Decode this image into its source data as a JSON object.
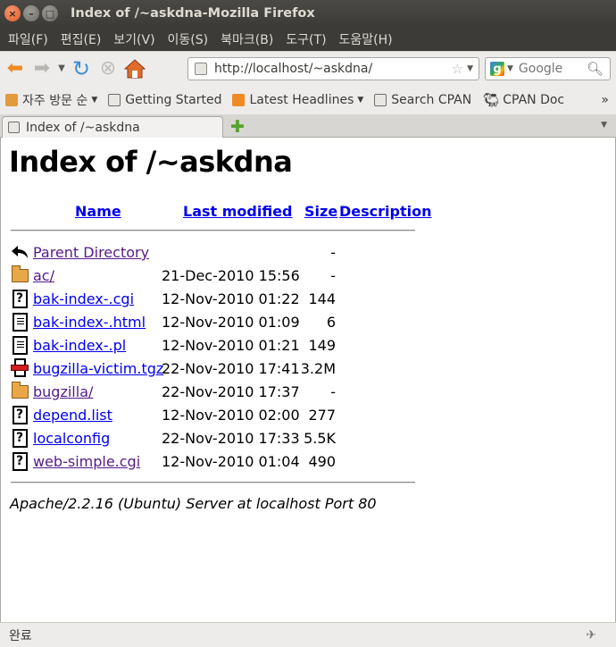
{
  "window": {
    "title": "Index of /~askdna-Mozilla Firefox"
  },
  "menu": [
    "파일(F)",
    "편집(E)",
    "보기(V)",
    "이동(S)",
    "북마크(B)",
    "도구(T)",
    "도움말(H)"
  ],
  "nav": {
    "url": "http://localhost/~askdna/",
    "search_placeholder": "Google"
  },
  "bookmarks": {
    "items": [
      "자주 방문 순",
      "Getting Started",
      "Latest Headlines",
      "Search CPAN",
      "CPAN Doc"
    ],
    "more": "»"
  },
  "tab": {
    "label": "Index of /~askdna"
  },
  "page": {
    "title": "Index of /~askdna",
    "headers": {
      "name": "Name",
      "modified": "Last modified",
      "size": "Size",
      "description": "Description"
    },
    "rows": [
      {
        "icon": "back-icon",
        "name": "Parent Directory",
        "date": "",
        "size": "-",
        "visited": true
      },
      {
        "icon": "folder-icon",
        "name": "ac/",
        "date": "21-Dec-2010 15:56",
        "size": "-",
        "visited": true
      },
      {
        "icon": "unknown-file-icon",
        "name": "bak-index-.cgi",
        "date": "12-Nov-2010 01:22",
        "size": "144",
        "visited": false
      },
      {
        "icon": "text-file-icon",
        "name": "bak-index-.html",
        "date": "12-Nov-2010 01:09",
        "size": "6",
        "visited": false
      },
      {
        "icon": "text-file-icon",
        "name": "bak-index-.pl",
        "date": "12-Nov-2010 01:21",
        "size": "149",
        "visited": false
      },
      {
        "icon": "archive-icon",
        "name": "bugzilla-victim.tgz",
        "date": "22-Nov-2010 17:41",
        "size": "3.2M",
        "visited": false
      },
      {
        "icon": "folder-icon",
        "name": "bugzilla/",
        "date": "22-Nov-2010 17:37",
        "size": "-",
        "visited": true
      },
      {
        "icon": "unknown-file-icon",
        "name": "depend.list",
        "date": "12-Nov-2010 02:00",
        "size": "277",
        "visited": false
      },
      {
        "icon": "unknown-file-icon",
        "name": "localconfig",
        "date": "22-Nov-2010 17:33",
        "size": "5.5K",
        "visited": false
      },
      {
        "icon": "unknown-file-icon",
        "name": "web-simple.cgi",
        "date": "12-Nov-2010 01:04",
        "size": "490",
        "visited": true
      }
    ],
    "address": "Apache/2.2.16 (Ubuntu) Server at localhost Port 80"
  },
  "status": {
    "text": "완료"
  }
}
